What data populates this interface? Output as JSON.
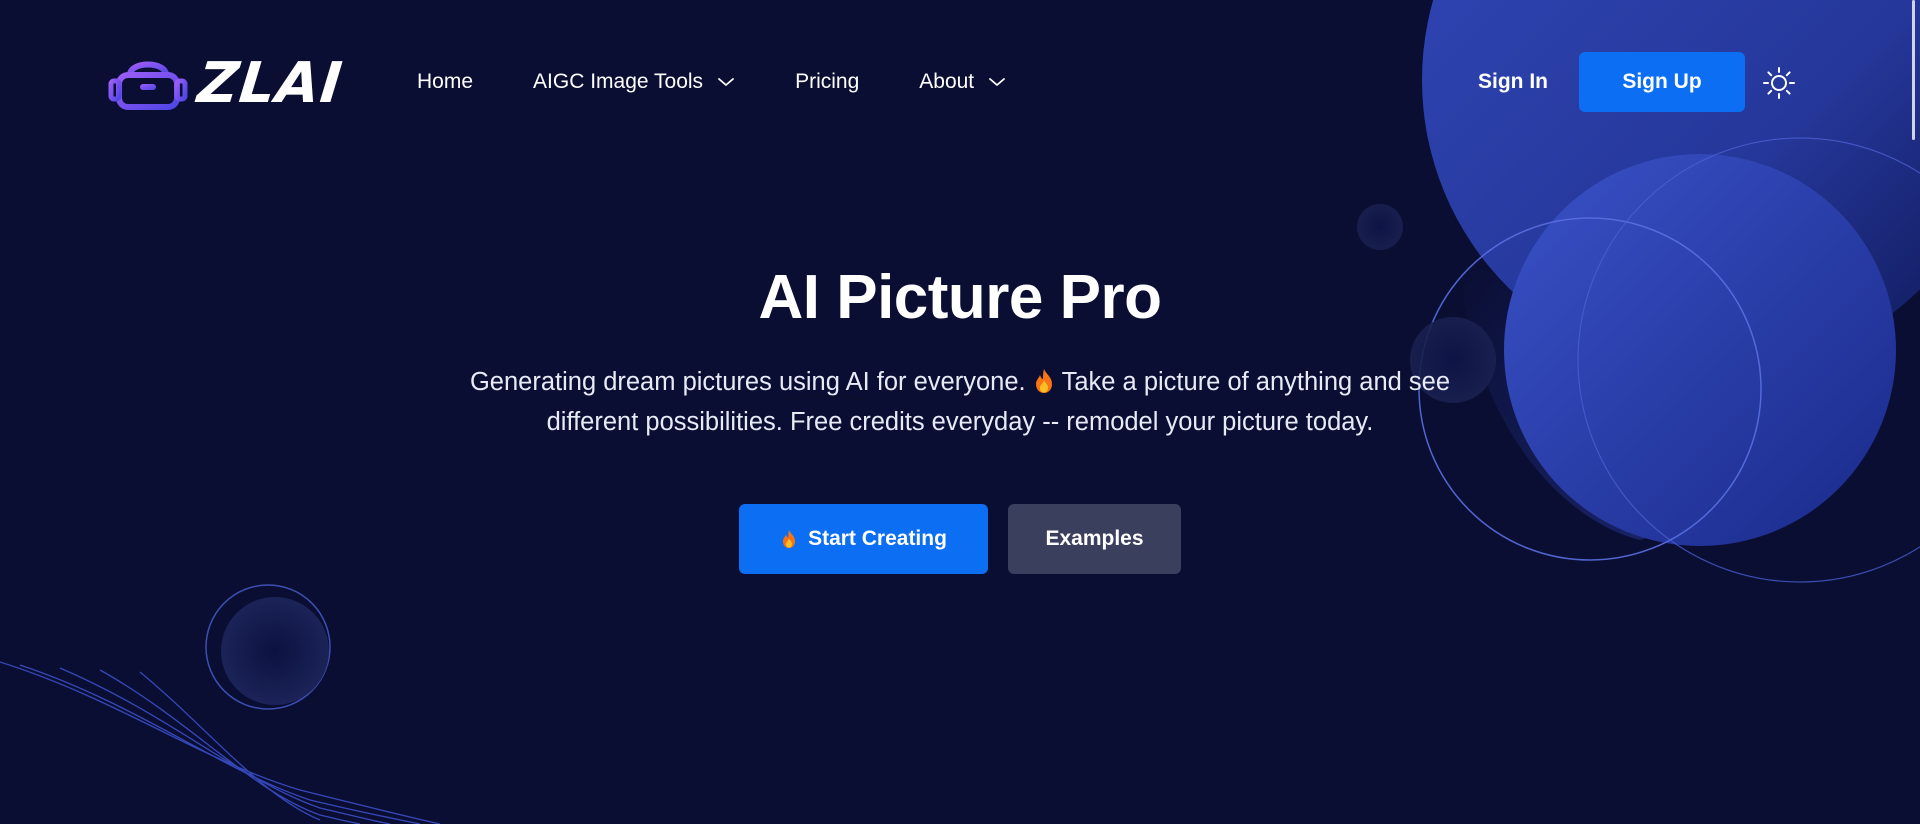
{
  "brand": {
    "name": "ZLAI",
    "logo_icon": "vr-headset-icon"
  },
  "nav": {
    "items": [
      {
        "label": "Home",
        "has_dropdown": false
      },
      {
        "label": "AIGC Image Tools",
        "has_dropdown": true
      },
      {
        "label": "Pricing",
        "has_dropdown": false
      },
      {
        "label": "About",
        "has_dropdown": true
      }
    ]
  },
  "auth": {
    "sign_in_label": "Sign In",
    "sign_up_label": "Sign Up"
  },
  "theme_toggle_icon": "sun-icon",
  "hero": {
    "title": "AI Picture Pro",
    "subtitle_part1": "Generating dream pictures ",
    "subtitle_underlined": "using AI",
    "subtitle_part2": " for everyone.",
    "subtitle_part3": "Take a picture of anything and see different possibilities. Free credits everyday -- remodel your picture today.",
    "start_label": "Start Creating",
    "examples_label": "Examples"
  },
  "colors": {
    "background": "#0a0e33",
    "primary": "#0b6ef3",
    "secondary_button": "#3b3f5e",
    "logo_gradient_start": "#8b5cf6",
    "logo_gradient_end": "#4f46e5",
    "accent_circle": "#2f45b8"
  }
}
